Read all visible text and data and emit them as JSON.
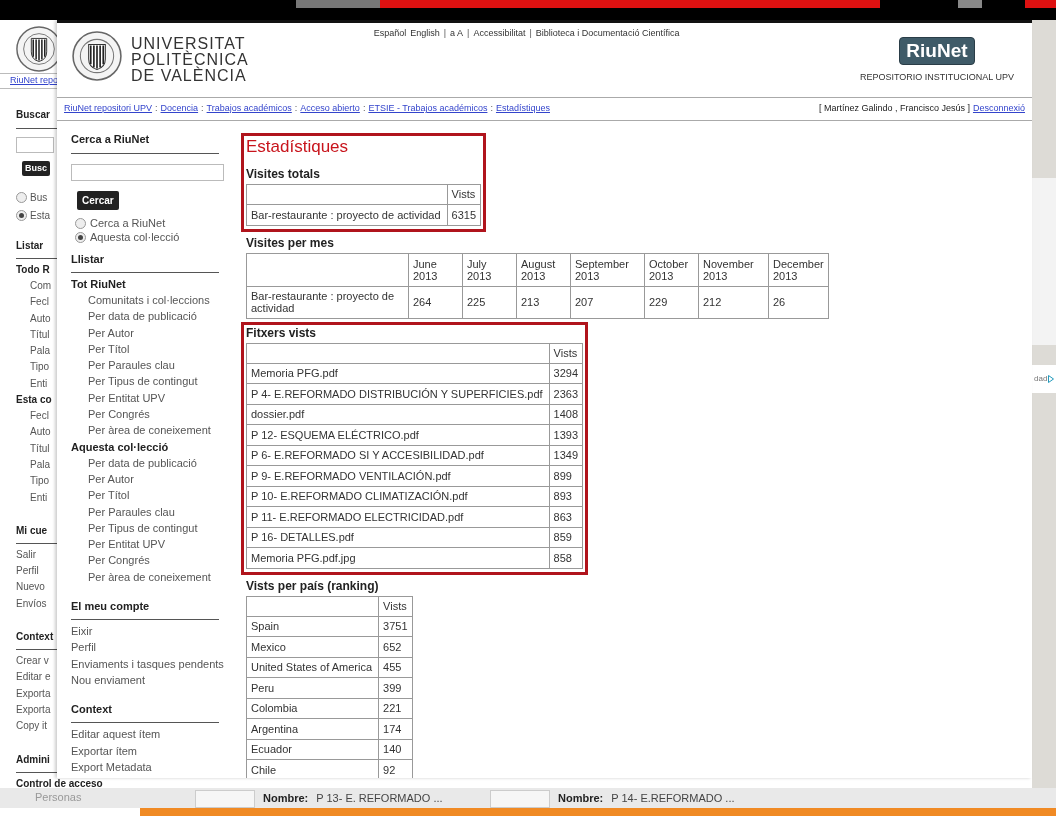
{
  "background_page": {
    "breadcrumb_link": "RiuNet repo",
    "search": {
      "heading": "Buscar",
      "button": "Busc",
      "radios": [
        {
          "label": "Bus",
          "selected": false
        },
        {
          "label": "Esta",
          "selected": true
        }
      ]
    },
    "sections": [
      {
        "heading": "Listar",
        "groups": [
          {
            "title": "Todo R",
            "items": [
              "Com",
              "Fecl",
              "Auto",
              "Títul",
              "Pala",
              "Tipo",
              "Enti"
            ]
          },
          {
            "title": "Esta co",
            "items": [
              "Fecl",
              "Auto",
              "Títul",
              "Pala",
              "Tipo",
              "Enti"
            ]
          }
        ]
      },
      {
        "heading": "Mi cue",
        "groups": [
          {
            "items": [
              "Salir",
              "Perfil",
              "Nuevo",
              "Envíos"
            ]
          }
        ]
      },
      {
        "heading": "Context",
        "groups": [
          {
            "items": [
              "Crear v",
              "Editar e",
              "Exporta",
              "Exporta",
              "Copy it"
            ]
          }
        ]
      },
      {
        "heading": "Admini",
        "groups": [
          {
            "title": "Control de acceso"
          }
        ]
      }
    ],
    "footer_item": "Personas",
    "results": [
      {
        "label": "Nombre:",
        "value": "P 13- E. REFORMADO ..."
      },
      {
        "label": "Nombre:",
        "value": "P 14- E.REFORMADO ..."
      }
    ],
    "side_fragment": "dad"
  },
  "main_page": {
    "university_name": [
      "UNIVERSITAT",
      "POLITÈCNICA",
      "DE VALÈNCIA"
    ],
    "top_links": [
      {
        "kind": "link",
        "text": "Español"
      },
      {
        "kind": "link",
        "text": "English"
      },
      {
        "kind": "separator",
        "text": "|"
      },
      {
        "kind": "link",
        "text": "a A"
      },
      {
        "kind": "separator",
        "text": "|"
      },
      {
        "kind": "link",
        "text": "Accessibilitat"
      },
      {
        "kind": "separator",
        "text": "|"
      },
      {
        "kind": "link",
        "text": "Biblioteca i Documentació Científica"
      }
    ],
    "logo_text": "RiuNet",
    "repository_label": "REPOSITORIO INSTITUCIONAL UPV",
    "breadcrumb": [
      {
        "kind": "link",
        "text": "RiuNet repositori UPV"
      },
      {
        "kind": "separator",
        "text": ":"
      },
      {
        "kind": "link",
        "text": "Docencia"
      },
      {
        "kind": "separator",
        "text": ":"
      },
      {
        "kind": "link",
        "text": "Trabajos académicos"
      },
      {
        "kind": "separator",
        "text": ":"
      },
      {
        "kind": "link",
        "text": "Acceso abierto"
      },
      {
        "kind": "separator",
        "text": ":"
      },
      {
        "kind": "link",
        "text": "ETSIE - Trabajos académicos"
      },
      {
        "kind": "separator",
        "text": ":"
      },
      {
        "kind": "link",
        "text": "Estadístiques"
      }
    ],
    "user": "[ Martínez Galindo , Francisco Jesús ]",
    "logout": "Desconnexió",
    "sidebar": {
      "search": {
        "heading": "Cerca a RiuNet",
        "button": "Cercar",
        "radios": [
          {
            "label": "Cerca a RiuNet",
            "selected": false
          },
          {
            "label": "Aquesta col·lecció",
            "selected": true
          }
        ]
      },
      "sections": [
        {
          "heading": "Llistar",
          "groups": [
            {
              "title": "Tot RiuNet",
              "items": [
                "Comunitats i col·leccions",
                "Per data de publicació",
                "Per Autor",
                "Per Títol",
                "Per Paraules clau",
                "Per Tipus de contingut",
                "Per Entitat UPV",
                "Per Congrés",
                "Per àrea de coneixement"
              ]
            },
            {
              "title": "Aquesta col·lecció",
              "items": [
                "Per data de publicació",
                "Per Autor",
                "Per Títol",
                "Per Paraules clau",
                "Per Tipus de contingut",
                "Per Entitat UPV",
                "Per Congrés",
                "Per àrea de coneixement"
              ]
            }
          ]
        },
        {
          "heading": "El meu compte",
          "groups": [
            {
              "items": [
                "Eixir",
                "Perfil",
                "Enviaments i tasques pendents",
                "Nou enviament"
              ]
            }
          ]
        },
        {
          "heading": "Context",
          "groups": [
            {
              "items": [
                "Editar aquest ítem",
                "Exportar ítem",
                "Export Metadata"
              ]
            }
          ]
        }
      ]
    },
    "stats": {
      "groups": [
        {
          "highlighted": true,
          "title": "Estadístiques",
          "sections": [
            {
              "kind": "list",
              "heading": "Visites totals",
              "value_header": "Vists",
              "rows": [
                {
                  "name": "Bar-restaurante : proyecto de actividad",
                  "value": "6315"
                }
              ]
            }
          ]
        },
        {
          "highlighted": false,
          "sections": [
            {
              "kind": "monthly",
              "heading": "Visites per mes",
              "months": [
                "June 2013",
                "July 2013",
                "August 2013",
                "September 2013",
                "October 2013",
                "November 2013",
                "December 2013"
              ],
              "rows": [
                {
                  "name": "Bar-restaurante : proyecto de actividad",
                  "values": [
                    "264",
                    "225",
                    "213",
                    "207",
                    "229",
                    "212",
                    "26"
                  ]
                }
              ]
            }
          ]
        },
        {
          "highlighted": true,
          "sections": [
            {
              "kind": "list",
              "heading": "Fitxers vists",
              "value_header": "Vists",
              "rows": [
                {
                  "name": "Memoria PFG.pdf",
                  "value": "3294"
                },
                {
                  "name": "P 4- E.REFORMADO DISTRIBUCIÓN Y SUPERFICIES.pdf",
                  "value": "2363"
                },
                {
                  "name": "dossier.pdf",
                  "value": "1408"
                },
                {
                  "name": "P 12- ESQUEMA ELÉCTRICO.pdf",
                  "value": "1393"
                },
                {
                  "name": "P 6- E.REFORMADO SI Y ACCESIBILIDAD.pdf",
                  "value": "1349"
                },
                {
                  "name": "P 9- E.REFORMADO VENTILACIÓN.pdf",
                  "value": "899"
                },
                {
                  "name": "P 10- E.REFORMADO CLIMATIZACIÓN.pdf",
                  "value": "893"
                },
                {
                  "name": "P 11- E.REFORMADO ELECTRICIDAD.pdf",
                  "value": "863"
                },
                {
                  "name": "P 16- DETALLES.pdf",
                  "value": "859"
                },
                {
                  "name": "Memoria PFG.pdf.jpg",
                  "value": "858"
                }
              ]
            }
          ]
        },
        {
          "highlighted": false,
          "sections": [
            {
              "kind": "list",
              "heading": "Vists per país (ranking)",
              "value_header": "Vists",
              "rows": [
                {
                  "name": "Spain",
                  "value": "3751"
                },
                {
                  "name": "Mexico",
                  "value": "652"
                },
                {
                  "name": "United States of America",
                  "value": "455"
                },
                {
                  "name": "Peru",
                  "value": "399"
                },
                {
                  "name": "Colombia",
                  "value": "221"
                },
                {
                  "name": "Argentina",
                  "value": "174"
                },
                {
                  "name": "Ecuador",
                  "value": "140"
                },
                {
                  "name": "Chile",
                  "value": "92"
                }
              ]
            }
          ]
        }
      ]
    }
  }
}
